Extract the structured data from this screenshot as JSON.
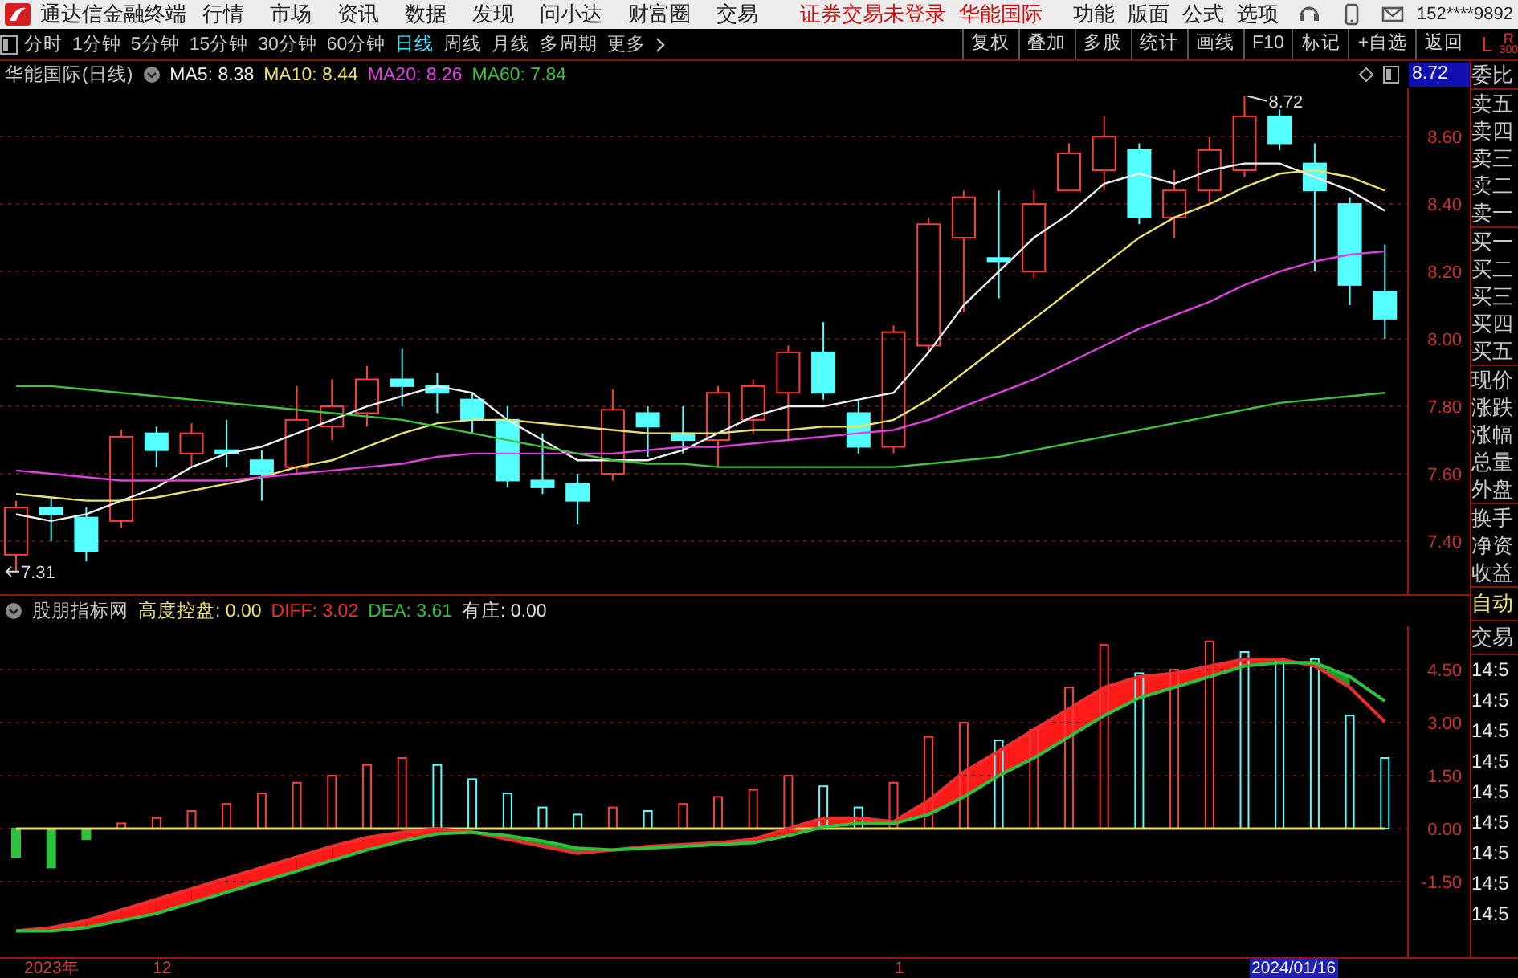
{
  "app": {
    "title": "通达信金融终端",
    "menu": [
      "行情",
      "市场",
      "资讯",
      "数据",
      "发现",
      "问小达",
      "财富圈",
      "交易"
    ],
    "notice": "证券交易未登录",
    "stock": "华能国际",
    "right_menu": [
      "功能",
      "版面",
      "公式",
      "选项"
    ],
    "user": "152****9892"
  },
  "period_tabs": [
    {
      "label": "分时",
      "selected": false
    },
    {
      "label": "1分钟",
      "selected": false
    },
    {
      "label": "5分钟",
      "selected": false
    },
    {
      "label": "15分钟",
      "selected": false
    },
    {
      "label": "30分钟",
      "selected": false
    },
    {
      "label": "60分钟",
      "selected": false
    },
    {
      "label": "日线",
      "selected": true
    },
    {
      "label": "周线",
      "selected": false
    },
    {
      "label": "月线",
      "selected": false
    },
    {
      "label": "多周期",
      "selected": false
    },
    {
      "label": "更多",
      "selected": false
    }
  ],
  "tools": [
    "复权",
    "叠加",
    "多股",
    "统计",
    "画线",
    "F10",
    "标记",
    "+自选",
    "返回"
  ],
  "panel_toggle": {
    "left": "L",
    "right": "R",
    "sub": "300"
  },
  "price_chart": {
    "title": "华能国际(日线)",
    "last_price": "8.72",
    "high_marker": "8.72",
    "low_marker": "7.31",
    "chart_data": {
      "type": "candlestick",
      "grid": true,
      "ylim": [
        7.243,
        8.743
      ],
      "yticks": [
        {
          "value": 8.6,
          "label": "8.60"
        },
        {
          "value": 8.4,
          "label": "8.40"
        },
        {
          "value": 8.2,
          "label": "8.20"
        },
        {
          "value": 8.0,
          "label": "8.00"
        },
        {
          "value": 7.8,
          "label": "7.80"
        },
        {
          "value": 7.6,
          "label": "7.60"
        },
        {
          "value": 7.4,
          "label": "7.40"
        }
      ],
      "ohlc": [
        [
          7.36,
          7.52,
          7.31,
          7.5
        ],
        [
          7.5,
          7.53,
          7.4,
          7.48
        ],
        [
          7.47,
          7.5,
          7.34,
          7.37
        ],
        [
          7.46,
          7.73,
          7.44,
          7.71
        ],
        [
          7.72,
          7.74,
          7.62,
          7.67
        ],
        [
          7.66,
          7.75,
          7.62,
          7.72
        ],
        [
          7.67,
          7.76,
          7.62,
          7.66
        ],
        [
          7.64,
          7.67,
          7.52,
          7.6
        ],
        [
          7.62,
          7.86,
          7.6,
          7.76
        ],
        [
          7.74,
          7.88,
          7.7,
          7.8
        ],
        [
          7.78,
          7.92,
          7.74,
          7.88
        ],
        [
          7.88,
          7.97,
          7.8,
          7.86
        ],
        [
          7.86,
          7.9,
          7.78,
          7.84
        ],
        [
          7.82,
          7.84,
          7.72,
          7.76
        ],
        [
          7.76,
          7.8,
          7.56,
          7.58
        ],
        [
          7.58,
          7.72,
          7.54,
          7.56
        ],
        [
          7.57,
          7.6,
          7.45,
          7.52
        ],
        [
          7.6,
          7.85,
          7.58,
          7.79
        ],
        [
          7.78,
          7.8,
          7.65,
          7.74
        ],
        [
          7.72,
          7.8,
          7.66,
          7.7
        ],
        [
          7.7,
          7.86,
          7.62,
          7.84
        ],
        [
          7.76,
          7.88,
          7.72,
          7.86
        ],
        [
          7.84,
          7.98,
          7.7,
          7.96
        ],
        [
          7.96,
          8.05,
          7.82,
          7.84
        ],
        [
          7.78,
          7.82,
          7.66,
          7.68
        ],
        [
          7.68,
          8.04,
          7.66,
          8.02
        ],
        [
          7.98,
          8.36,
          7.96,
          8.34
        ],
        [
          8.3,
          8.44,
          8.08,
          8.42
        ],
        [
          8.24,
          8.44,
          8.12,
          8.23
        ],
        [
          8.2,
          8.44,
          8.18,
          8.4
        ],
        [
          8.44,
          8.58,
          8.44,
          8.55
        ],
        [
          8.5,
          8.66,
          8.44,
          8.6
        ],
        [
          8.56,
          8.58,
          8.34,
          8.36
        ],
        [
          8.36,
          8.5,
          8.3,
          8.44
        ],
        [
          8.44,
          8.6,
          8.4,
          8.56
        ],
        [
          8.5,
          8.72,
          8.48,
          8.66
        ],
        [
          8.66,
          8.68,
          8.56,
          8.58
        ],
        [
          8.52,
          8.58,
          8.2,
          8.44
        ],
        [
          8.4,
          8.42,
          8.1,
          8.16
        ],
        [
          8.14,
          8.28,
          8.0,
          8.06
        ]
      ],
      "series": [
        {
          "name": "MA5: 8.38",
          "color": "#f0f0f0",
          "type": "line",
          "values": [
            7.48,
            7.46,
            7.48,
            7.52,
            7.56,
            7.62,
            7.66,
            7.68,
            7.72,
            7.76,
            7.8,
            7.83,
            7.86,
            7.84,
            7.76,
            7.7,
            7.64,
            7.64,
            7.64,
            7.67,
            7.72,
            7.77,
            7.8,
            7.8,
            7.82,
            7.84,
            7.96,
            8.1,
            8.2,
            8.3,
            8.37,
            8.46,
            8.49,
            8.46,
            8.5,
            8.52,
            8.52,
            8.48,
            8.44,
            8.38
          ]
        },
        {
          "name": "MA10: 8.44",
          "color": "#e8e070",
          "type": "line",
          "values": [
            7.54,
            7.53,
            7.52,
            7.52,
            7.53,
            7.55,
            7.57,
            7.59,
            7.62,
            7.64,
            7.68,
            7.72,
            7.75,
            7.76,
            7.76,
            7.75,
            7.74,
            7.73,
            7.72,
            7.72,
            7.72,
            7.73,
            7.73,
            7.74,
            7.74,
            7.76,
            7.82,
            7.9,
            7.98,
            8.06,
            8.14,
            8.22,
            8.3,
            8.36,
            8.4,
            8.45,
            8.49,
            8.5,
            8.48,
            8.44
          ]
        },
        {
          "name": "MA20: 8.26",
          "color": "#e040e0",
          "type": "line",
          "values": [
            7.61,
            7.6,
            7.59,
            7.58,
            7.58,
            7.58,
            7.58,
            7.59,
            7.6,
            7.61,
            7.62,
            7.63,
            7.65,
            7.66,
            7.66,
            7.66,
            7.66,
            7.66,
            7.67,
            7.68,
            7.68,
            7.69,
            7.7,
            7.71,
            7.72,
            7.73,
            7.76,
            7.8,
            7.84,
            7.88,
            7.93,
            7.98,
            8.03,
            8.07,
            8.11,
            8.16,
            8.2,
            8.23,
            8.25,
            8.26
          ]
        },
        {
          "name": "MA60: 7.84",
          "color": "#40c040",
          "type": "line",
          "values": [
            7.86,
            7.86,
            7.85,
            7.84,
            7.83,
            7.82,
            7.81,
            7.8,
            7.79,
            7.78,
            7.77,
            7.76,
            7.74,
            7.72,
            7.7,
            7.68,
            7.66,
            7.64,
            7.63,
            7.63,
            7.62,
            7.62,
            7.62,
            7.62,
            7.62,
            7.62,
            7.63,
            7.64,
            7.65,
            7.67,
            7.69,
            7.71,
            7.73,
            7.75,
            7.77,
            7.79,
            7.81,
            7.82,
            7.83,
            7.84
          ]
        }
      ]
    }
  },
  "indicator": {
    "title": "股朋指标网",
    "extra_values": [
      {
        "label": "有庄: 0.00",
        "color": "#e0e0e0"
      }
    ],
    "chart_data": {
      "type": "bar",
      "grid": true,
      "ylim": [
        -3.636,
        5.727
      ],
      "yticks": [
        {
          "value": 4.5,
          "label": "4.50"
        },
        {
          "value": 3.0,
          "label": "3.00"
        },
        {
          "value": 1.5,
          "label": "1.50"
        },
        {
          "value": 0,
          "label": "0.00"
        },
        {
          "value": -1.5,
          "label": "-1.50"
        }
      ],
      "series": [
        {
          "colors": [
            "#30c040",
            "#30c040",
            "#30c040",
            "#ff3c3c",
            "#ff3c3c",
            "#ff3c3c",
            "#ff3c3c",
            "#ff3c3c",
            "#ff3c3c",
            "#ff3c3c",
            "#ff3c3c",
            "#ff3c3c",
            "#54ffff",
            "#54ffff",
            "#54ffff",
            "#54ffff",
            "#54ffff",
            "#ff3c3c",
            "#54ffff",
            "#ff3c3c",
            "#ff3c3c",
            "#ff3c3c",
            "#ff3c3c",
            "#54ffff",
            "#54ffff",
            "#ff3c3c",
            "#ff3c3c",
            "#ff3c3c",
            "#54ffff",
            "#ff3c3c",
            "#ff3c3c",
            "#ff3c3c",
            "#54ffff",
            "#ff3c3c",
            "#ff3c3c",
            "#54ffff",
            "#54ffff",
            "#54ffff",
            "#54ffff",
            "#54ffff"
          ],
          "values": [
            -0.8,
            -1.1,
            -0.3,
            0.15,
            0.3,
            0.5,
            0.7,
            1.0,
            1.3,
            1.5,
            1.8,
            2.0,
            1.8,
            1.4,
            1.0,
            0.6,
            0.4,
            0.6,
            0.5,
            0.7,
            0.9,
            1.1,
            1.5,
            1.2,
            0.6,
            1.3,
            2.6,
            3.0,
            2.5,
            2.8,
            4.0,
            5.2,
            4.4,
            4.5,
            5.3,
            5.0,
            4.8,
            4.8,
            3.2,
            2.0
          ]
        },
        {
          "name": "高度控盘: 0.00",
          "color": "#e8e070",
          "type": "line",
          "values": [
            0,
            0,
            0,
            0,
            0,
            0,
            0,
            0,
            0,
            0,
            0,
            0,
            0,
            0,
            0,
            0,
            0,
            0,
            0,
            0,
            0,
            0,
            0,
            0,
            0,
            0,
            0,
            0,
            0,
            0,
            0,
            0,
            0,
            0,
            0,
            0,
            0,
            0,
            0,
            0
          ]
        },
        {
          "name": "DIFF: 3.02",
          "color": "#e83030",
          "type": "line",
          "values": [
            -2.9,
            -2.8,
            -2.6,
            -2.3,
            -2.0,
            -1.7,
            -1.4,
            -1.1,
            -0.8,
            -0.5,
            -0.25,
            -0.1,
            0.0,
            -0.1,
            -0.3,
            -0.5,
            -0.7,
            -0.6,
            -0.5,
            -0.45,
            -0.4,
            -0.3,
            0.0,
            0.3,
            0.3,
            0.2,
            0.8,
            1.6,
            2.2,
            2.8,
            3.4,
            4.0,
            4.3,
            4.4,
            4.6,
            4.8,
            4.8,
            4.6,
            4.0,
            3.02
          ]
        },
        {
          "name": "DEA: 3.61",
          "color": "#30c040",
          "type": "line",
          "values": [
            -2.9,
            -2.9,
            -2.8,
            -2.6,
            -2.4,
            -2.1,
            -1.8,
            -1.5,
            -1.2,
            -0.9,
            -0.6,
            -0.35,
            -0.15,
            -0.1,
            -0.2,
            -0.35,
            -0.55,
            -0.6,
            -0.55,
            -0.5,
            -0.45,
            -0.4,
            -0.2,
            0.05,
            0.15,
            0.15,
            0.4,
            0.9,
            1.5,
            2.0,
            2.6,
            3.2,
            3.7,
            4.0,
            4.3,
            4.6,
            4.7,
            4.7,
            4.3,
            3.61
          ]
        }
      ]
    }
  },
  "date_axis": [
    {
      "label": "2023年",
      "selected": false
    },
    {
      "label": "12",
      "selected": false
    },
    {
      "label": "1",
      "selected": false
    },
    {
      "label": "2024/01/16",
      "selected": true
    }
  ],
  "quote_panel": {
    "labels": [
      "委比",
      "卖五",
      "卖四",
      "卖三",
      "卖二",
      "卖一",
      "买一",
      "买二",
      "买三",
      "买四",
      "买五",
      "现价",
      "涨跌",
      "涨幅",
      "总量",
      "外盘",
      "换手",
      "净资",
      "收益"
    ],
    "auto": "自动",
    "trade": "交易",
    "times": [
      "14:5",
      "14:5",
      "14:5",
      "14:5",
      "14:5",
      "14:5",
      "14:5",
      "14:5",
      "14:5"
    ]
  }
}
